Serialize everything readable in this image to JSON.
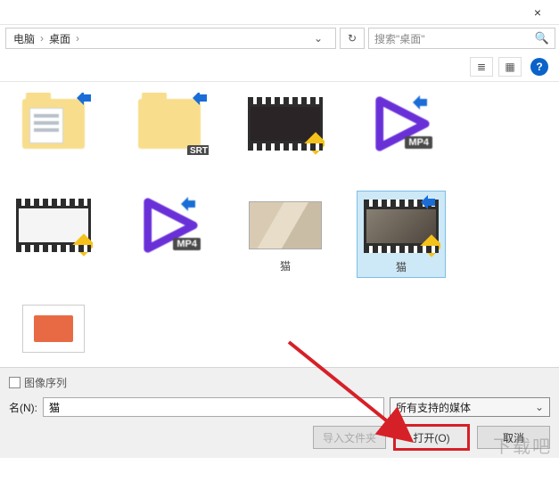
{
  "titlebar": {
    "close": "×"
  },
  "breadcrumb": {
    "part1": "电脑",
    "sep": "›",
    "part2": "桌面",
    "tail": "›"
  },
  "refresh": {
    "glyph": "↻"
  },
  "search": {
    "placeholder": "搜索\"桌面\"",
    "icon": "🔍"
  },
  "toolbar": {
    "view1": "≣",
    "view2": "▦",
    "help": "?"
  },
  "files": {
    "f1": {
      "label": ""
    },
    "f2": {
      "label": "",
      "srt": "SRT"
    },
    "f3": {
      "label": ""
    },
    "f4": {
      "label": "",
      "mp4": "MP4"
    },
    "f5": {
      "label": ""
    },
    "f6": {
      "label": "",
      "mp4": "MP4"
    },
    "f7": {
      "label": "猫"
    },
    "f8": {
      "label": "猫"
    },
    "f9": {
      "label": ""
    }
  },
  "checkbox": {
    "label": "图像序列"
  },
  "filename": {
    "prefix": "名(N):",
    "value": "猫"
  },
  "filetype": {
    "selected": "所有支持的媒体",
    "chev": "⌄"
  },
  "buttons": {
    "import": "导入文件夹",
    "open": "打开(O)",
    "cancel": "取消"
  },
  "watermark": "下载吧"
}
